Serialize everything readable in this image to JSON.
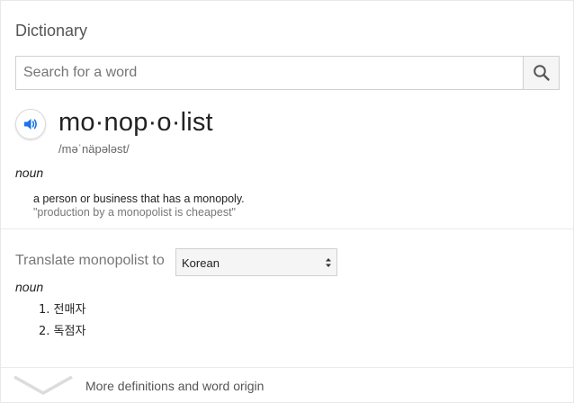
{
  "dictionary": {
    "title": "Dictionary",
    "search": {
      "placeholder": "Search for a word",
      "value": "",
      "icon": "search-icon"
    },
    "entry": {
      "headword": "mo·nop·o·list",
      "phonetic": "/məˈnäpələst/",
      "speaker_icon": "speaker-icon",
      "part_of_speech": "noun",
      "definition": "a person or business that has a monopoly.",
      "example": "\"production by a monopolist is cheapest\""
    },
    "translate": {
      "label": "Translate monopolist to",
      "language": "Korean",
      "part_of_speech": "noun",
      "items": [
        {
          "number": "1.",
          "text": "전매자"
        },
        {
          "number": "2.",
          "text": "독점자"
        }
      ]
    },
    "more": {
      "label": "More definitions and word origin",
      "icon": "chevron-down-icon"
    },
    "colors": {
      "accent_blue": "#1a73e8",
      "text": "#222222",
      "muted": "#777777",
      "border": "#d0d0d0"
    }
  }
}
